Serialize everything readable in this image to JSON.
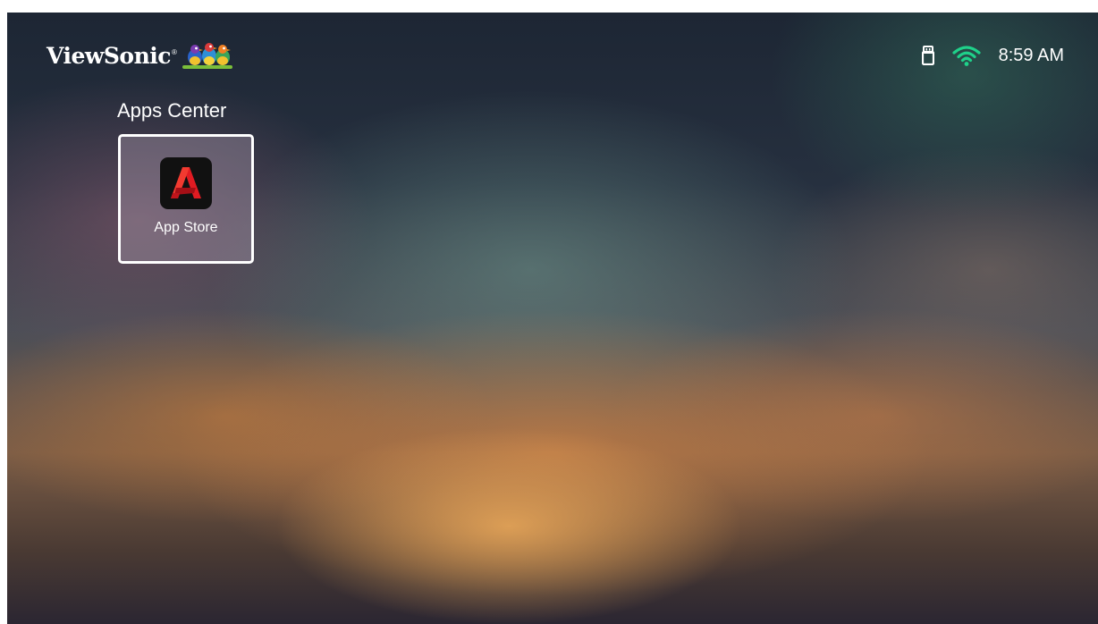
{
  "header": {
    "brand": "ViewSonic",
    "brand_mark": "®",
    "logo_icon": "birds-logo-icon",
    "status": {
      "usb_icon": "usb-drive-icon",
      "wifi_icon": "wifi-icon",
      "wifi_color": "#1fd18a",
      "time": "8:59 AM"
    }
  },
  "main": {
    "section_title": "Apps Center",
    "apps": [
      {
        "label": "App Store",
        "icon": "app-store-icon",
        "focused": true,
        "accent": "#e11b22"
      }
    ]
  }
}
